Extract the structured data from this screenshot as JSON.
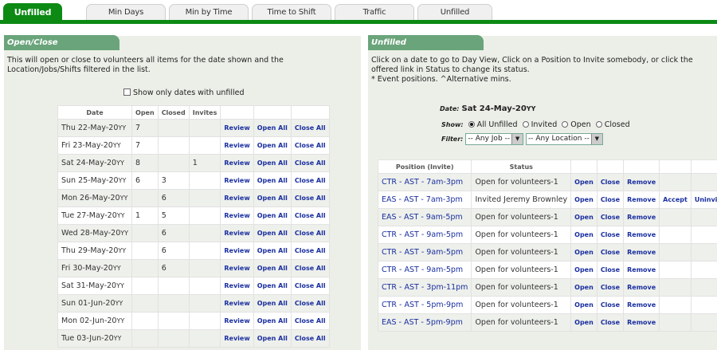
{
  "tabs": [
    {
      "label": "Unfilled",
      "active": true
    },
    {
      "label": "Min Days"
    },
    {
      "label": "Min by Time"
    },
    {
      "label": "Time to Shift"
    },
    {
      "label": "Traffic"
    },
    {
      "label": "Unfilled"
    }
  ],
  "left": {
    "title": "Open/Close",
    "intro": "This will open or close to volunteers all items for the date shown and the Location/Jobs/Shifts filtered in the list.",
    "checkbox_label": "Show only dates with unfilled",
    "headers": [
      "Date",
      "Open",
      "Closed",
      "Invites"
    ],
    "actions": [
      "Review",
      "Open All",
      "Close All"
    ],
    "rows": [
      {
        "date": "Thu 22-May-20",
        "yy": "YY",
        "open": "7",
        "closed": "",
        "invites": ""
      },
      {
        "date": "Fri 23-May-20",
        "yy": "YY",
        "open": "7",
        "closed": "",
        "invites": ""
      },
      {
        "date": "Sat 24-May-20",
        "yy": "YY",
        "open": "8",
        "closed": "",
        "invites": "1"
      },
      {
        "date": "Sun 25-May-20",
        "yy": "YY",
        "open": "6",
        "closed": "3",
        "invites": ""
      },
      {
        "date": "Mon 26-May-20",
        "yy": "YY",
        "open": "",
        "closed": "6",
        "invites": ""
      },
      {
        "date": "Tue 27-May-20",
        "yy": "YY",
        "open": "1",
        "closed": "5",
        "invites": ""
      },
      {
        "date": "Wed 28-May-20",
        "yy": "YY",
        "open": "",
        "closed": "6",
        "invites": ""
      },
      {
        "date": "Thu 29-May-20",
        "yy": "YY",
        "open": "",
        "closed": "6",
        "invites": ""
      },
      {
        "date": "Fri 30-May-20",
        "yy": "YY",
        "open": "",
        "closed": "6",
        "invites": ""
      },
      {
        "date": "Sat 31-May-20",
        "yy": "YY",
        "open": "",
        "closed": "",
        "invites": ""
      },
      {
        "date": "Sun 01-Jun-20",
        "yy": "YY",
        "open": "",
        "closed": "",
        "invites": ""
      },
      {
        "date": "Mon 02-Jun-20",
        "yy": "YY",
        "open": "",
        "closed": "",
        "invites": ""
      },
      {
        "date": "Tue 03-Jun-20",
        "yy": "YY",
        "open": "",
        "closed": "",
        "invites": ""
      }
    ]
  },
  "right": {
    "title": "Unfilled",
    "intro1": "Click on a date to go to Day View, Click on a Position to Invite somebody, or click the offered link in Status to change its status.",
    "intro2": "*  Event positions. ^Alternative mins.",
    "date_label": "Date:",
    "date_value": "Sat 24-May-20",
    "date_yy": "YY",
    "show_label": "Show:",
    "show_options": [
      "All Unfilled",
      "Invited",
      "Open",
      "Closed"
    ],
    "filter_label": "Filter:",
    "filter_job": "-- Any Job --",
    "filter_location": "-- Any Location --",
    "headers": [
      "Position (Invite)",
      "Status"
    ],
    "rows": [
      {
        "position": "CTR - AST - 7am-3pm",
        "status": "Open for volunteers-1",
        "actions": [
          "Open",
          "Close",
          "Remove"
        ]
      },
      {
        "position": "EAS - AST - 7am-3pm",
        "status": "Invited Jeremy Brownley",
        "actions": [
          "Open",
          "Close",
          "Remove",
          "Accept",
          "Uninvite"
        ]
      },
      {
        "position": "EAS - AST - 9am-5pm",
        "status": "Open for volunteers-1",
        "actions": [
          "Open",
          "Close",
          "Remove"
        ]
      },
      {
        "position": "CTR - AST - 9am-5pm",
        "status": "Open for volunteers-1",
        "actions": [
          "Open",
          "Close",
          "Remove"
        ]
      },
      {
        "position": "CTR - AST - 9am-5pm",
        "status": "Open for volunteers-1",
        "actions": [
          "Open",
          "Close",
          "Remove"
        ]
      },
      {
        "position": "CTR - AST - 9am-5pm",
        "status": "Open for volunteers-1",
        "actions": [
          "Open",
          "Close",
          "Remove"
        ]
      },
      {
        "position": "CTR - AST - 3pm-11pm",
        "status": "Open for volunteers-1",
        "actions": [
          "Open",
          "Close",
          "Remove"
        ]
      },
      {
        "position": "CTR - AST - 5pm-9pm",
        "status": "Open for volunteers-1",
        "actions": [
          "Open",
          "Close",
          "Remove"
        ]
      },
      {
        "position": "EAS - AST - 5pm-9pm",
        "status": "Open for volunteers-1",
        "actions": [
          "Open",
          "Close",
          "Remove"
        ]
      }
    ]
  }
}
